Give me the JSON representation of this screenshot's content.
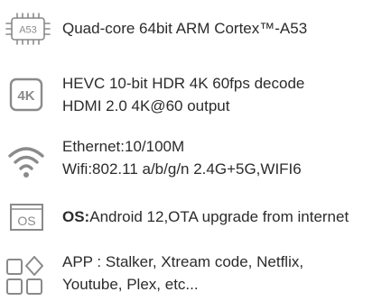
{
  "colors": {
    "icon_stroke": "#8a8a8a",
    "text": "#2b2b2b"
  },
  "specs": [
    {
      "icon": "cpu-chip-icon",
      "icon_label": "A53",
      "lines": [
        "Quad-core 64bit ARM Cortex™-A53"
      ]
    },
    {
      "icon": "4k-icon",
      "icon_label": "4K",
      "lines": [
        "HEVC 10-bit HDR 4K 60fps decode",
        "HDMI 2.0 4K@60 output"
      ]
    },
    {
      "icon": "wifi-icon",
      "lines": [
        "Ethernet:10/100M",
        "Wifi:802.11 a/b/g/n 2.4G+5G,WIFI6"
      ]
    },
    {
      "icon": "os-icon",
      "icon_label": "OS",
      "prefix": "OS:",
      "lines": [
        "Android 12,OTA upgrade from internet"
      ]
    },
    {
      "icon": "apps-grid-icon",
      "lines": [
        "APP : Stalker, Xtream code, Netflix,",
        "Youtube, Plex, etc..."
      ]
    }
  ]
}
